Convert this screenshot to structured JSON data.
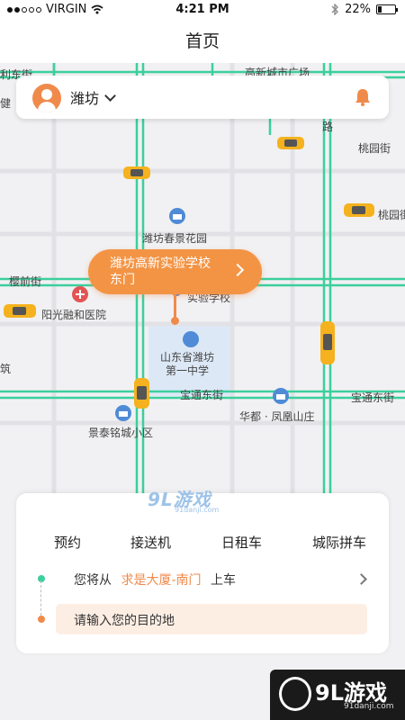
{
  "status_bar": {
    "carrier": "VIRGIN",
    "time": "4:21 PM",
    "battery": "22%",
    "battery_level": 0.22
  },
  "nav": {
    "title": "首页"
  },
  "location_bar": {
    "city": "潍坊"
  },
  "map": {
    "labels": {
      "top_street_left": "利东街",
      "top_left_edge": "健",
      "top_street_mid": "高新城市广场",
      "right_street_top": "路",
      "taoyuan_1": "桃园街",
      "taoyuan_2": "桃园街",
      "yingqian": "樱前街",
      "chunjing": "潍坊春景花园",
      "hospital": "阳光融和医院",
      "school_behind": "实验学校",
      "school_name": "山东省潍坊\n第一中学",
      "zhu": "筑",
      "baotong_1": "宝通东街",
      "baotong_2": "宝通东街",
      "huadu": "华都 · 凤凰山庄",
      "jingtai": "景泰铭城小区"
    },
    "pickup_bubble": "潍坊高新实验学校\n东门"
  },
  "watermark": {
    "brand": "9L游戏",
    "site": "91danji.com"
  },
  "service_tabs": [
    "预约",
    "接送机",
    "日租车",
    "城际拼车"
  ],
  "pickup": {
    "prefix": "您将从",
    "place": "求是大厦-南门",
    "suffix": "上车"
  },
  "destination": {
    "placeholder": "请输入您的目的地"
  },
  "corner_logo": {
    "brand": "9L游戏",
    "site": "91danji.com"
  },
  "colors": {
    "accent": "#f08a4b",
    "road_green": "#3ccf9c",
    "start_dot": "#3ccf9c",
    "input_bg": "#fdeee4",
    "taxi": "#f5b21e"
  }
}
